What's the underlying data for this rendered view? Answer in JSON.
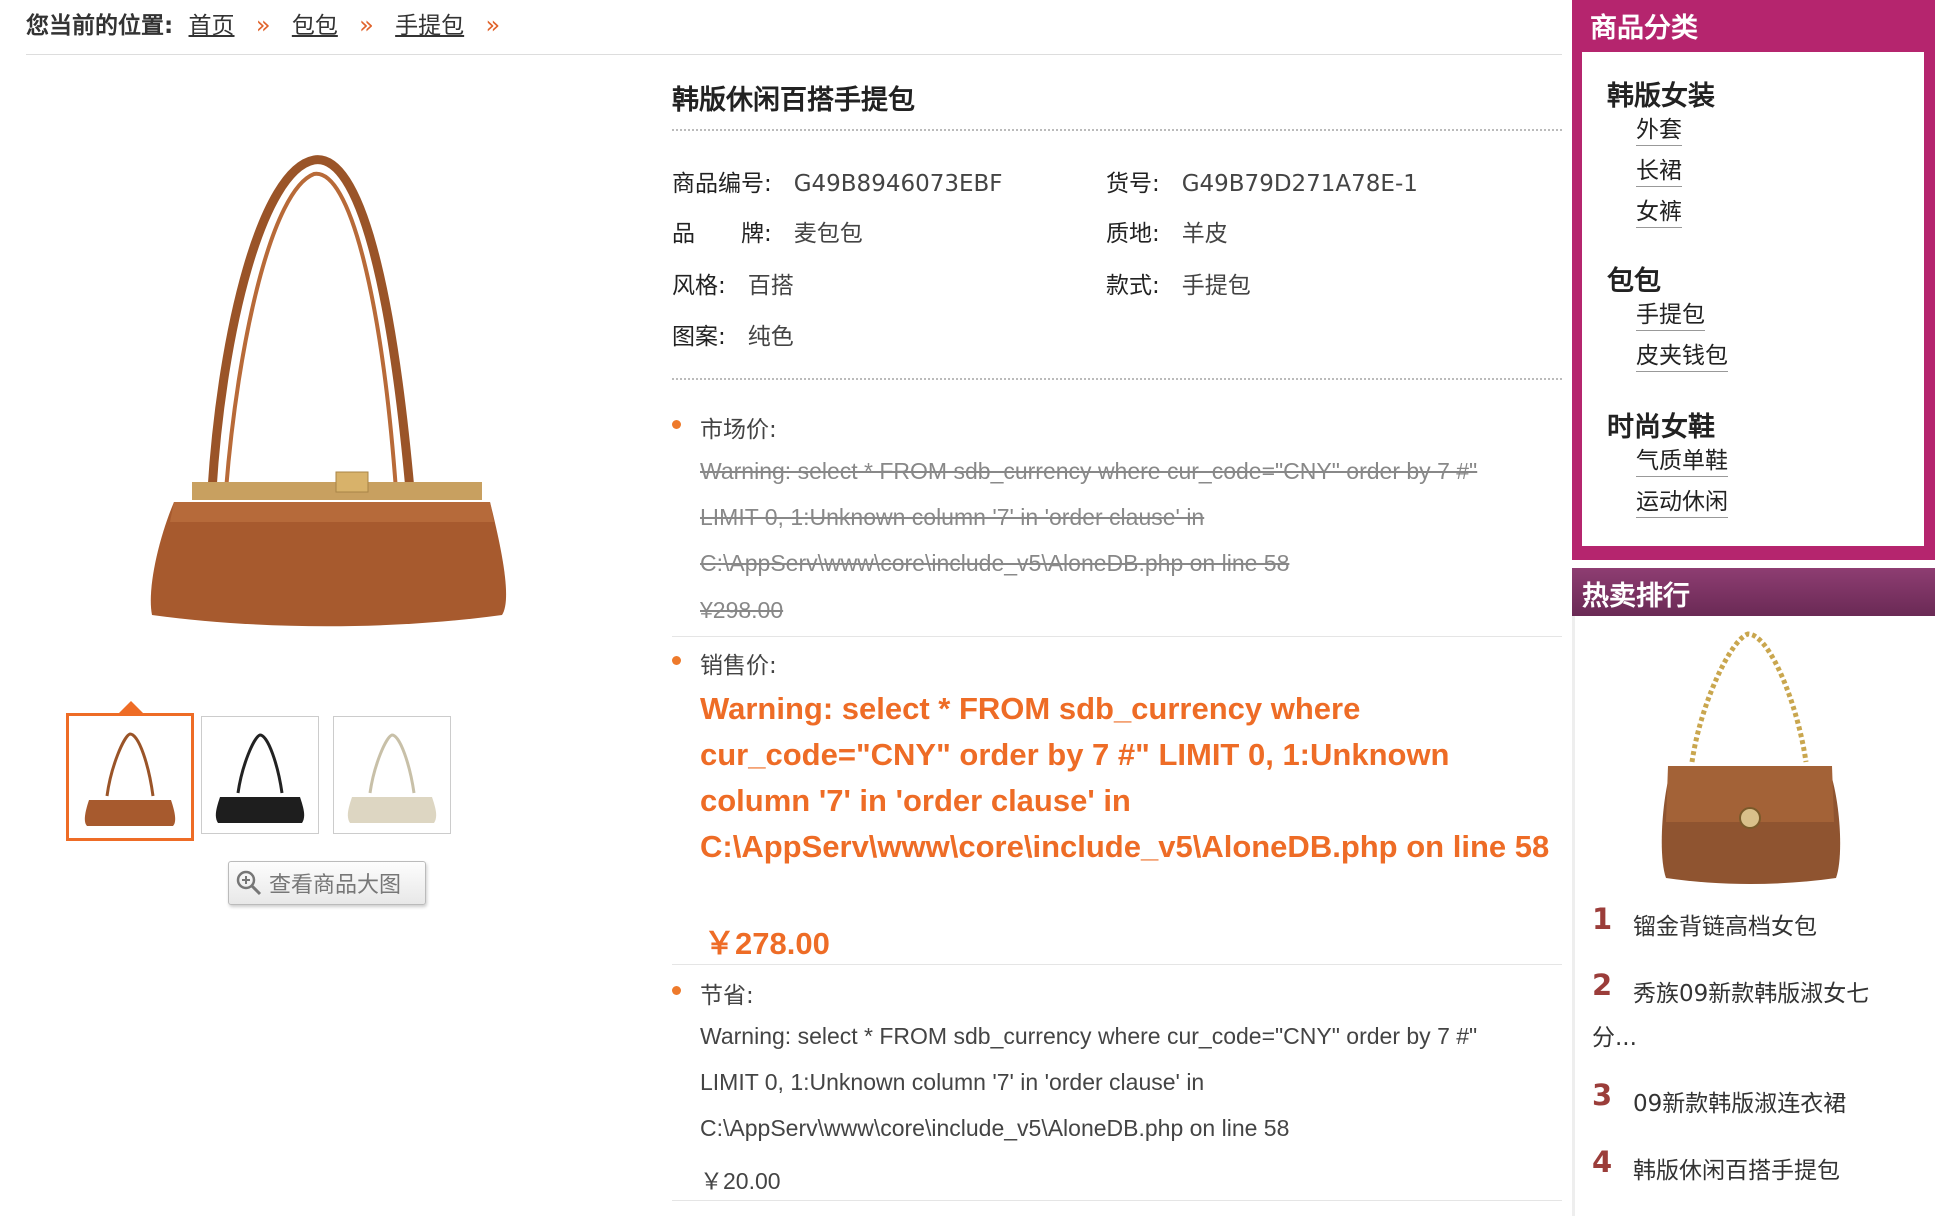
{
  "breadcrumb": {
    "lead": "您当前的位置:",
    "items": [
      "首页",
      "包包",
      "手提包"
    ],
    "separator": "»"
  },
  "gallery": {
    "zoom_label": "查看商品大图",
    "thumbnails": [
      "brown",
      "black",
      "cream"
    ]
  },
  "product": {
    "title": "韩版休闲百搭手提包",
    "attrs": {
      "product_no_label": "商品编号:",
      "product_no": "G49B8946073EBF",
      "sku_label": "货号:",
      "sku": "G49B79D271A78E-1",
      "brand_label": "品　　牌:",
      "brand": "麦包包",
      "material_label": "质地:",
      "material": "羊皮",
      "style_label": "风格:",
      "style": "百搭",
      "type_label": "款式:",
      "type": "手提包",
      "pattern_label": "图案:",
      "pattern": "纯色"
    }
  },
  "prices": {
    "market_label": "市场价:",
    "market_warning": [
      "Warning: select * FROM sdb_currency where cur_code=\"CNY\" order by 7 #\"",
      "LIMIT 0, 1:Unknown column '7' in 'order clause' in",
      "C:\\AppServ\\www\\core\\include_v5\\AloneDB.php on line 58"
    ],
    "market_price": "¥298.00",
    "sale_label": "销售价:",
    "sale_warning": "Warning: select * FROM sdb_currency where cur_code=\"CNY\" order by 7 #\" LIMIT 0, 1:Unknown column '7' in 'order clause' in C:\\AppServ\\www\\core\\include_v5\\AloneDB.php on line 58",
    "sale_price": "￥278.00",
    "save_label": "节省:",
    "save_warning": [
      "Warning: select * FROM sdb_currency where cur_code=\"CNY\" order by 7 #\"",
      "LIMIT 0, 1:Unknown column '7' in 'order clause' in",
      "C:\\AppServ\\www\\core\\include_v5\\AloneDB.php on line 58"
    ],
    "save_amount": "￥20.00"
  },
  "sidebar": {
    "categories_title": "商品分类",
    "groups": [
      {
        "name": "韩版女装",
        "items": [
          "外套",
          "长裙",
          "女裤"
        ]
      },
      {
        "name": "包包",
        "items": [
          "手提包",
          "皮夹钱包"
        ]
      },
      {
        "name": "时尚女鞋",
        "items": [
          "气质单鞋",
          "运动休闲"
        ]
      }
    ],
    "hot_title": "热卖排行",
    "hot_items": [
      {
        "rank": "1",
        "name": "镏金背链高档女包"
      },
      {
        "rank": "2",
        "name": "秀族09新款韩版淑女七",
        "name2": "分..."
      },
      {
        "rank": "3",
        "name": "09新款韩版淑连衣裙"
      },
      {
        "rank": "4",
        "name": "韩版休闲百搭手提包"
      }
    ]
  },
  "colors": {
    "accent": "#ee6c26",
    "sidebar": "#b5256e",
    "hot_bar": "#7a3361",
    "bag": "#a75a2e"
  }
}
